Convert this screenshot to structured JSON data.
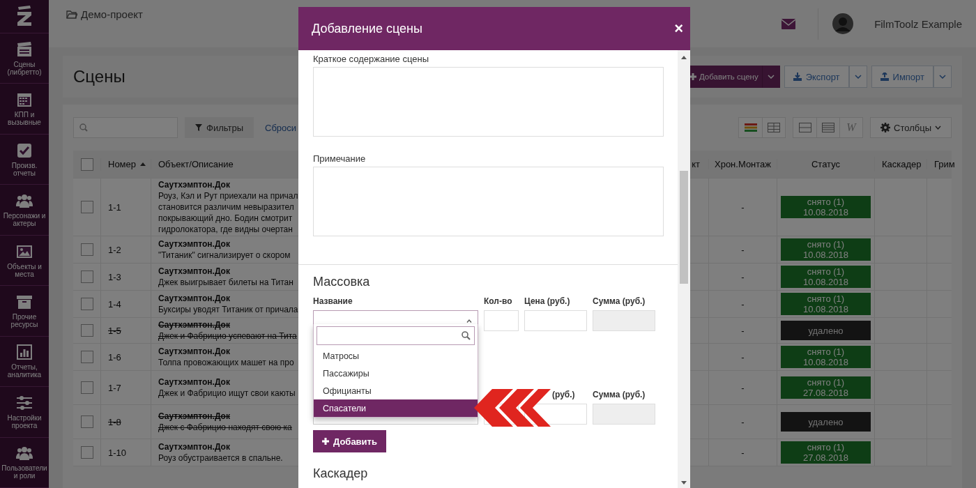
{
  "header": {
    "project": "Демо-проект",
    "user": "FilmToolz Example"
  },
  "sidebar": {
    "items": [
      {
        "label": "Сцены (либретто)"
      },
      {
        "label": "КПП и вызывные"
      },
      {
        "label": "Произв. отчеты"
      },
      {
        "label": "Персонажи и актеры"
      },
      {
        "label": "Объекты и места"
      },
      {
        "label": "Прочие ресурсы"
      },
      {
        "label": "Отчеты, аналитика"
      },
      {
        "label": "Настройки проекта"
      },
      {
        "label": "Пользователи и роли"
      }
    ]
  },
  "page": {
    "title": "Сцены",
    "actions": [
      {
        "label": "Добавить сцену",
        "kind": "primary"
      },
      {
        "label": "Экспорт",
        "kind": "export"
      },
      {
        "label": "Импорт",
        "kind": "import"
      }
    ]
  },
  "toolbar": {
    "filter": "Фильтры",
    "reset": "Сброси",
    "view_w": "W",
    "columns": "Столбцы"
  },
  "table": {
    "select_all_checked": false,
    "columns": [
      "Номер",
      "Объект/Описание",
      "кт",
      "Хрон.Монтаж",
      "Статус",
      "Каскадер",
      "Грим"
    ],
    "rows": [
      {
        "number": "1-1",
        "checked": false,
        "deleted": false,
        "place": "Саутхэмптон.Док",
        "lines": [
          "Роуз, Кэл и Рут приехали на причал",
          "становится различим невыразител",
          "покрывающий дно. Бодин смотрит",
          "гидролокатора, где видны очертан"
        ],
        "chron": "-",
        "status": {
          "kind": "shot",
          "label": "снято (1)",
          "date": "10.08.2018"
        }
      },
      {
        "number": "1-2",
        "checked": false,
        "deleted": false,
        "place": "Саутхэмптон.Док",
        "lines": [
          "\"Титаник\" сигнализирует о скором"
        ],
        "chron": "-",
        "status": {
          "kind": "shot",
          "label": "снято (1)",
          "date": "10.08.2018"
        }
      },
      {
        "number": "1-3",
        "checked": false,
        "deleted": false,
        "place": "Саутхэмптон.Док",
        "lines": [
          "Джек выигрывает билеты на Титан"
        ],
        "chron": "-",
        "status": {
          "kind": "shot",
          "label": "снято (1)",
          "date": "10.08.2018"
        }
      },
      {
        "number": "1-4",
        "checked": false,
        "deleted": false,
        "place": "Саутхэмптон.Док",
        "lines": [
          "Буксиры уводят Титаник от причала"
        ],
        "chron": "-",
        "status": {
          "kind": "shot",
          "label": "снято (1)",
          "date": "10.08.2018"
        }
      },
      {
        "number": "1-5",
        "checked": false,
        "deleted": true,
        "place": "Саутхэмптон.Док",
        "lines": [
          "Джек и Фабрицио успевают на Тита"
        ],
        "chron": "-",
        "status": {
          "kind": "deleted",
          "label": "удалено"
        }
      },
      {
        "number": "1-6",
        "checked": false,
        "deleted": false,
        "place": "Саутхэмптон.Док",
        "lines": [
          "Толпа провожающих машет на про"
        ],
        "chron": "-",
        "status": {
          "kind": "shot",
          "label": "снято (1)",
          "date": "10.08.2018"
        }
      },
      {
        "number": "1-7",
        "checked": false,
        "deleted": false,
        "place": "Саутхэмптон.Док",
        "lines": [
          "Джек и Фабрицио ищут свои каюты"
        ],
        "chron": "-",
        "status": {
          "kind": "shot",
          "label": "снято (1)",
          "date": "27.08.2018"
        }
      },
      {
        "number": "1-8",
        "checked": false,
        "deleted": true,
        "place": "Саутхэмптон.Док",
        "lines": [
          "Джек с Фабрицио находят свою ка"
        ],
        "chron": "-",
        "status": {
          "kind": "deleted",
          "label": "удалено"
        }
      },
      {
        "number": "1-10",
        "checked": false,
        "deleted": false,
        "place": "Саутхэмптон.Док",
        "lines": [
          "Роуз обустраивается в спальне."
        ],
        "chron": "-",
        "status": {
          "kind": "shot",
          "label": "снято (1)",
          "date": "27.08.2018"
        }
      }
    ]
  },
  "modal": {
    "title": "Добавление сцены",
    "close": "×",
    "summary_label": "Краткое содержание сцены",
    "note_label": "Примечание",
    "massovka": {
      "heading": "Массовка",
      "labels": [
        "Название",
        "Кол-во",
        "Цена (руб.)",
        "Сумма (руб.)"
      ],
      "second_row_labels": [
        "(руб.)",
        "Сумма (руб.)"
      ],
      "dropdown": {
        "options": [
          {
            "label": "Матросы",
            "selected": false
          },
          {
            "label": "Пассажиры",
            "selected": false
          },
          {
            "label": "Официанты",
            "selected": false
          },
          {
            "label": "Спасатели",
            "selected": true
          }
        ]
      },
      "add_button": "Добавить"
    },
    "next_heading": "Каскадер"
  }
}
